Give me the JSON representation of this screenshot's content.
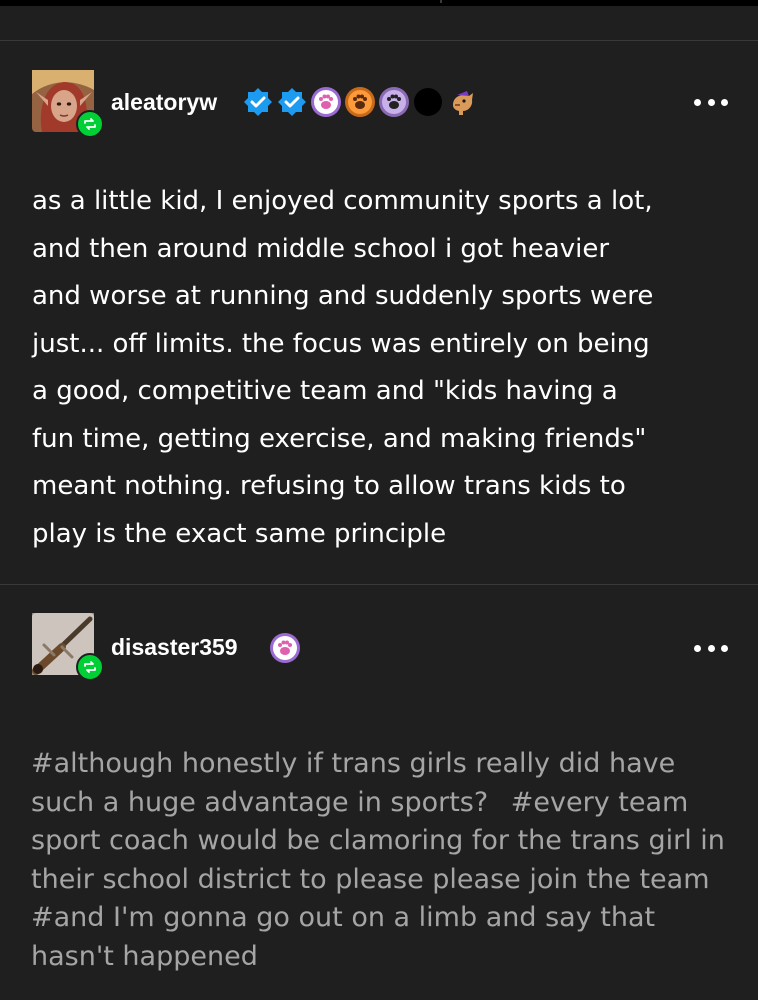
{
  "posts": [
    {
      "username": "aleatoryw",
      "badges": [
        "verified-badge",
        "verified-badge",
        "paw-badge",
        "paw-badge",
        "paw-badge",
        "dot-badge",
        "creature-badge"
      ],
      "body_lines": [
        "as a little kid, I enjoyed community sports a lot,",
        "and then around middle school i got heavier",
        "and worse at running and suddenly sports were",
        "just... off limits. the focus was entirely on being",
        "a good, competitive team and \"kids having a",
        "fun time, getting exercise, and making friends\"",
        "meant nothing. refusing to allow trans kids to",
        "play is the exact same principle"
      ]
    },
    {
      "username": "disaster359",
      "badges": [
        "paw-badge"
      ],
      "tags": [
        "#although honestly if trans girls really did have such a huge advantage in sports?",
        "#every team sport coach would be clamoring for the trans girl in their school district to please please join the team",
        "#and I'm gonna go out on a limb and say that hasn't happened"
      ]
    }
  ],
  "colors": {
    "background": "#1f1f1f",
    "reblog_green": "#00cf35",
    "verified_blue": "#1d9bf0",
    "tag_gray": "#a5a5a5"
  }
}
